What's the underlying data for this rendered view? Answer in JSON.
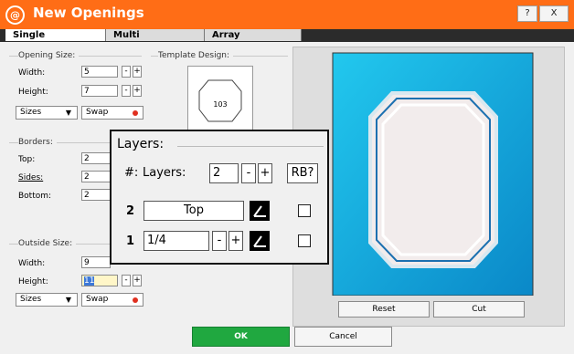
{
  "window": {
    "logo": "@",
    "title": "New Openings",
    "help_label": "?",
    "close_label": "X"
  },
  "tabs": [
    "Single",
    "Multi",
    "Array"
  ],
  "opening_size": {
    "label": "Opening Size:",
    "width_label": "Width:",
    "width_value": "5",
    "height_label": "Height:",
    "height_value": "7",
    "sizes_label": "Sizes",
    "swap_label": "Swap"
  },
  "template": {
    "label": "Template Design:",
    "code": "103"
  },
  "borders": {
    "label": "Borders:",
    "top_label": "Top:",
    "top_value": "2",
    "sides_label": "Sides:",
    "sides_value": "2",
    "bottom_label": "Bottom:",
    "bottom_value": "2"
  },
  "outside_size": {
    "label": "Outside Size:",
    "width_label": "Width:",
    "width_value": "9",
    "height_label": "Height:",
    "height_value": "11",
    "sizes_label": "Sizes",
    "swap_label": "Swap"
  },
  "stepper": {
    "minus": "-",
    "plus": "+"
  },
  "layers_popup": {
    "title": "Layers:",
    "hash_label": "#:",
    "layers_label": "Layers:",
    "layers_value": "2",
    "rb_label": "RB?",
    "rows": [
      {
        "num": "2",
        "value": "Top"
      },
      {
        "num": "1",
        "value": "1/4"
      }
    ]
  },
  "preview": {
    "reset_label": "Reset",
    "cut_label": "Cut"
  },
  "footer": {
    "ok_label": "OK",
    "cancel_label": "Cancel"
  },
  "colors": {
    "title_bar": "#ff6d16",
    "mat": "#1aa8e0",
    "ok": "#20a840"
  }
}
